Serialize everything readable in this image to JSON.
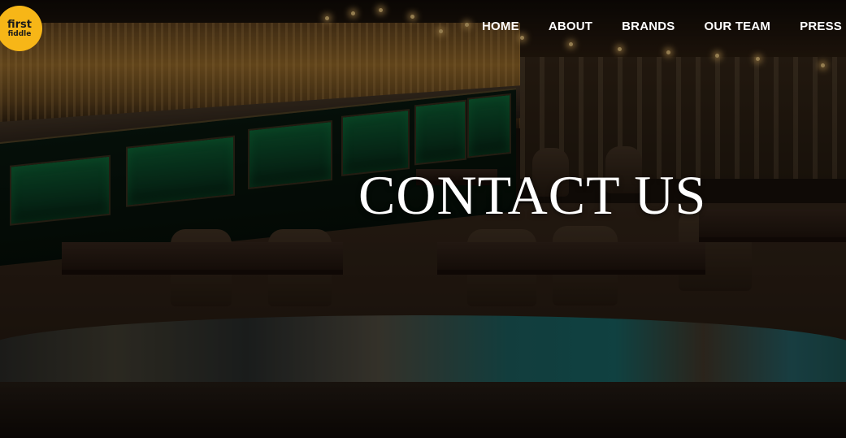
{
  "logo": {
    "line1": "first",
    "line2": "fiddle",
    "color": "#f7b617"
  },
  "nav": {
    "items": [
      {
        "label": "HOME"
      },
      {
        "label": "ABOUT"
      },
      {
        "label": "BRANDS"
      },
      {
        "label": "OUR TEAM"
      },
      {
        "label": "PRESS RE"
      }
    ]
  },
  "hero": {
    "title": "CONTACT US",
    "background_image": "restaurant-interior"
  }
}
